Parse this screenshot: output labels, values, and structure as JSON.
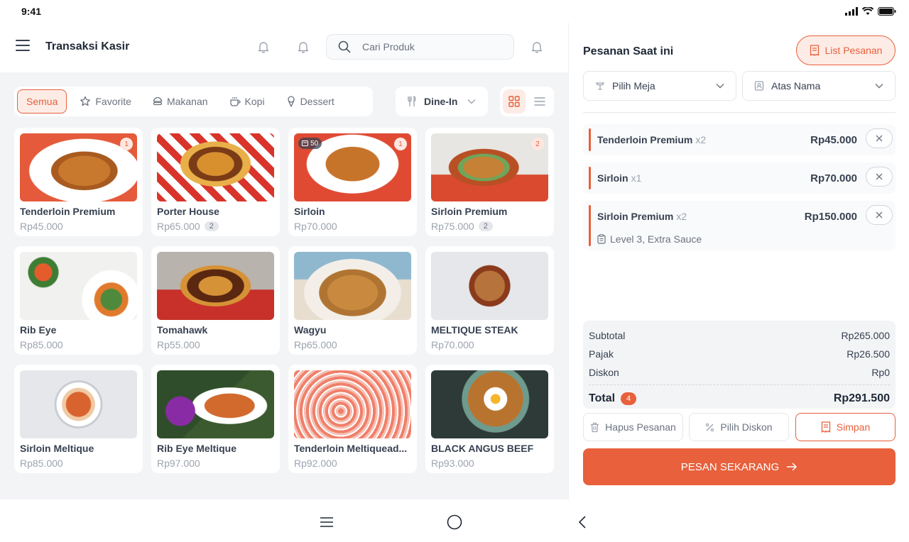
{
  "status": {
    "time": "9:41"
  },
  "header": {
    "title": "Transaksi Kasir"
  },
  "search": {
    "placeholder": "Cari Produk"
  },
  "categories": [
    {
      "label": "Semua",
      "icon": "none",
      "active": true
    },
    {
      "label": "Favorite",
      "icon": "star-icon"
    },
    {
      "label": "Makanan",
      "icon": "food-icon"
    },
    {
      "label": "Kopi",
      "icon": "coffee-icon"
    },
    {
      "label": "Dessert",
      "icon": "dessert-icon"
    }
  ],
  "service": {
    "selected": "Dine-In"
  },
  "products": [
    {
      "name": "Tenderloin Premium",
      "price": "Rp45.000",
      "badge": "1",
      "qty": "",
      "stock": ""
    },
    {
      "name": "Porter House",
      "price": "Rp65.000",
      "badge": "",
      "qty": "2",
      "stock": ""
    },
    {
      "name": "Sirloin",
      "price": "Rp70.000",
      "badge": "1",
      "qty": "",
      "stock": "50"
    },
    {
      "name": "Sirloin Premium",
      "price": "Rp75.000",
      "badge": "2",
      "qty": "2",
      "stock": ""
    },
    {
      "name": "Rib Eye",
      "price": "Rp85.000",
      "badge": "",
      "qty": "",
      "stock": ""
    },
    {
      "name": "Tomahawk",
      "price": "Rp55.000",
      "badge": "",
      "qty": "",
      "stock": ""
    },
    {
      "name": "Wagyu",
      "price": "Rp65.000",
      "badge": "",
      "qty": "",
      "stock": ""
    },
    {
      "name": "MELTIQUE STEAK",
      "price": "Rp70.000",
      "badge": "",
      "qty": "",
      "stock": ""
    },
    {
      "name": "Sirloin Meltique",
      "price": "Rp85.000",
      "badge": "",
      "qty": "",
      "stock": ""
    },
    {
      "name": "Rib Eye Meltique",
      "price": "Rp97.000",
      "badge": "",
      "qty": "",
      "stock": ""
    },
    {
      "name": "Tenderloin Meltiquead...",
      "price": "Rp92.000",
      "badge": "",
      "qty": "",
      "stock": ""
    },
    {
      "name": "BLACK ANGUS BEEF",
      "price": "Rp93.000",
      "badge": "",
      "qty": "",
      "stock": ""
    }
  ],
  "order": {
    "title": "Pesanan Saat ini",
    "list_button": "List Pesanan",
    "table_select": "Pilih Meja",
    "name_select": "Atas Nama",
    "items": [
      {
        "name": "Tenderloin Premium",
        "qty": "x2",
        "price": "Rp45.000",
        "note": ""
      },
      {
        "name": "Sirloin",
        "qty": "x1",
        "price": "Rp70.000",
        "note": ""
      },
      {
        "name": "Sirloin Premium",
        "qty": "x2",
        "price": "Rp150.000",
        "note": "Level 3, Extra Sauce"
      }
    ],
    "summary": {
      "subtotal_label": "Subtotal",
      "subtotal": "Rp265.000",
      "tax_label": "Pajak",
      "tax": "Rp26.500",
      "discount_label": "Diskon",
      "discount": "Rp0",
      "total_label": "Total",
      "total_count": "4",
      "total": "Rp291.500"
    },
    "actions": {
      "delete": "Hapus Pesanan",
      "discount": "Pilih Diskon",
      "save": "Simpan"
    },
    "submit": "PESAN SEKARANG"
  },
  "colors": {
    "accent": "#e8603c",
    "accent_light": "#fdece6",
    "background": "#f3f4f6"
  }
}
